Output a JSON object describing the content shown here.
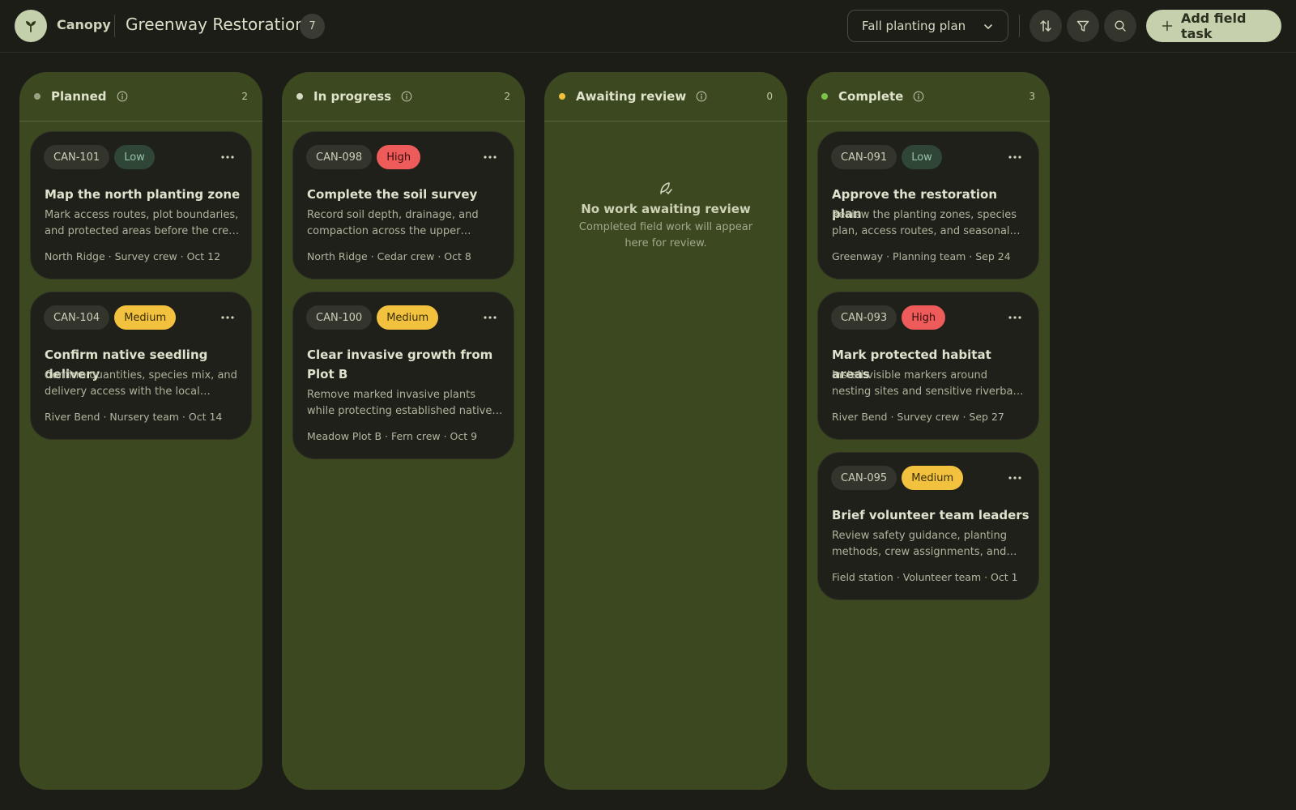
{
  "header": {
    "brand": "Canopy",
    "board_title": "Greenway Restoration",
    "task_count": "7",
    "plan_select": "Fall planting plan",
    "add_button": "Add field task"
  },
  "columns": [
    {
      "title": "Planned",
      "count": "2",
      "dot_color": "#9aa183",
      "cards": [
        {
          "id": "CAN-101",
          "priority": "Low",
          "title": "Map the north planting zone",
          "desc": "Mark access routes, plot boundaries, and protected areas before the crew arrives.",
          "meta": "North Ridge · Survey crew · Oct 12"
        },
        {
          "id": "CAN-104",
          "priority": "Medium",
          "title": "Confirm native seedling delivery",
          "desc": "Confirm quantities, species mix, and delivery access with the local nursery.",
          "meta": "River Bend · Nursery team · Oct 14"
        }
      ]
    },
    {
      "title": "In progress",
      "count": "2",
      "dot_color": "#d6dac4",
      "cards": [
        {
          "id": "CAN-098",
          "priority": "High",
          "title": "Complete the soil survey",
          "desc": "Record soil depth, drainage, and compaction across the upper planting terraces.",
          "meta": "North Ridge · Cedar crew · Oct 8"
        },
        {
          "id": "CAN-100",
          "priority": "Medium",
          "title": "Clear invasive growth from Plot B",
          "desc": "Remove marked invasive plants while protecting established native groundcover.",
          "meta": "Meadow Plot B · Fern crew · Oct 9"
        }
      ]
    },
    {
      "title": "Awaiting review",
      "count": "0",
      "dot_color": "#f2c23f",
      "empty_title": "No work awaiting review",
      "empty_text": "Completed field work will appear here for review."
    },
    {
      "title": "Complete",
      "count": "3",
      "dot_color": "#7cc34a",
      "cards": [
        {
          "id": "CAN-091",
          "priority": "Low",
          "title": "Approve the restoration plan",
          "desc": "Review the planting zones, species plan, access routes, and seasonal schedule.",
          "meta": "Greenway · Planning team · Sep 24"
        },
        {
          "id": "CAN-093",
          "priority": "High",
          "title": "Mark protected habitat areas",
          "desc": "Install visible markers around nesting sites and sensitive riverbank habitat.",
          "meta": "River Bend · Survey crew · Sep 27"
        },
        {
          "id": "CAN-095",
          "priority": "Medium",
          "title": "Brief volunteer team leaders",
          "desc": "Review safety guidance, planting methods, crew assignments, and check-in points.",
          "meta": "Field station · Volunteer team · Oct 1"
        }
      ]
    }
  ],
  "colors": {
    "background": "#1c1d16",
    "column": "#3c481f",
    "card": "#1f201a",
    "accent": "#c6d0ad",
    "priority_low": "#2f4535",
    "priority_medium": "#f2c23f",
    "priority_high": "#ee5b5b"
  }
}
